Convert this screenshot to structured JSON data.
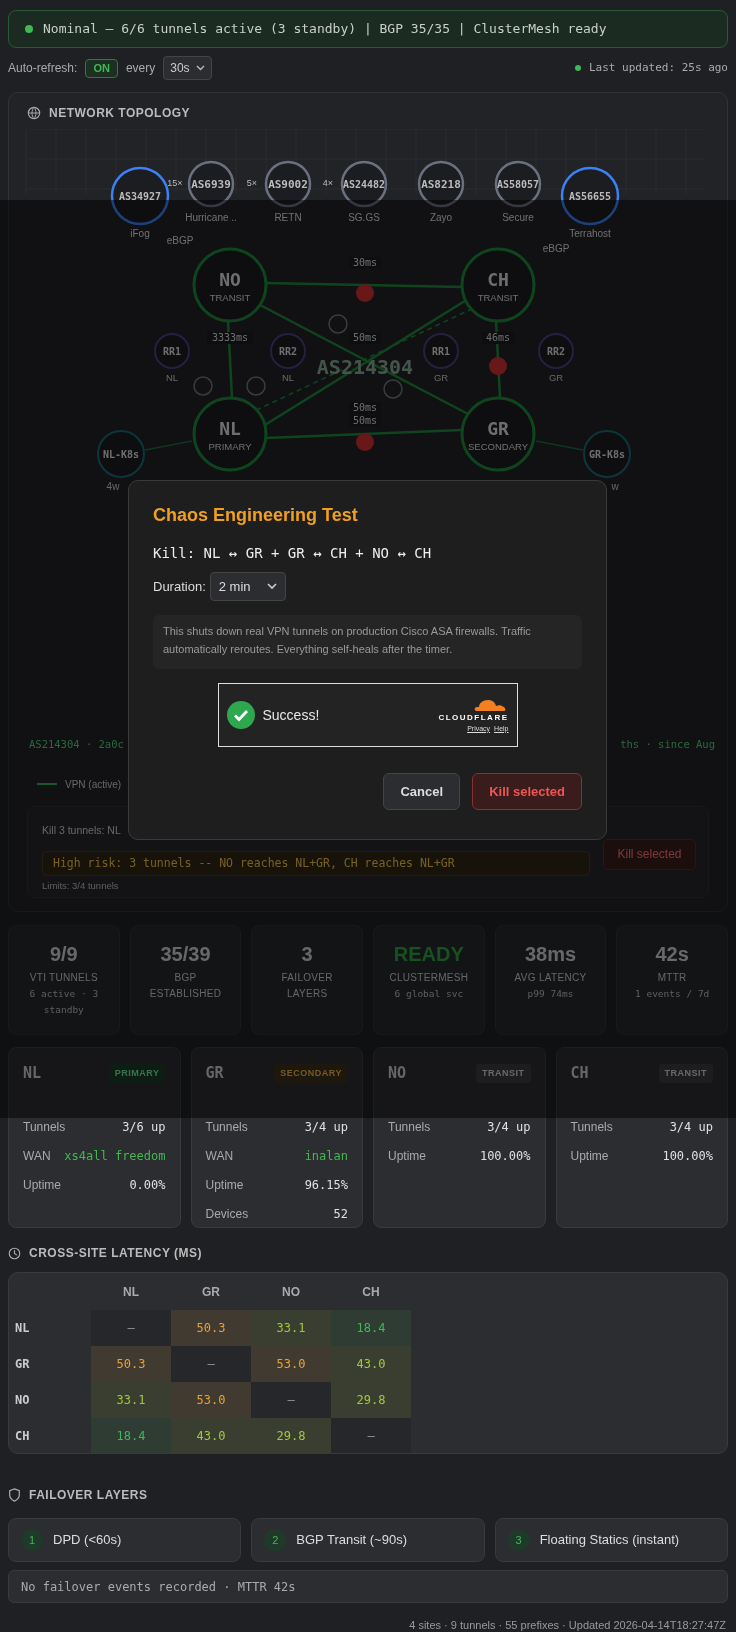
{
  "status_banner": {
    "text": "Nominal — 6/6 tunnels active (3 standby) | BGP 35/35 | ClusterMesh ready",
    "kind": "ok"
  },
  "auto_refresh": {
    "label": "Auto-refresh:",
    "toggle": "ON",
    "on": true,
    "every": "every",
    "interval": "30s"
  },
  "last_updated": {
    "text": "Last updated: 25s ago",
    "kind": "ok"
  },
  "topology": {
    "title": "NETWORK TOPOLOGY",
    "upstreams": [
      {
        "asn": "AS34927",
        "name": "iFog",
        "kind": "direct"
      },
      {
        "asn": "AS6939",
        "name": "Hurricane ..",
        "kind": "transit"
      },
      {
        "asn": "AS9002",
        "name": "RETN",
        "kind": "transit"
      },
      {
        "asn": "AS24482",
        "name": "SG.GS",
        "kind": "transit"
      },
      {
        "asn": "AS8218",
        "name": "Zayo",
        "kind": "transit"
      },
      {
        "asn": "AS58057",
        "name": "Secure",
        "kind": "transit"
      },
      {
        "asn": "AS56655",
        "name": "Terrahost",
        "kind": "direct"
      }
    ],
    "link_counts": [
      "15×",
      "5×",
      "4×"
    ],
    "bgp_labels": [
      "eBGP",
      "eBGP"
    ],
    "sites": [
      {
        "code": "NO",
        "role": "TRANSIT"
      },
      {
        "code": "CH",
        "role": "TRANSIT"
      },
      {
        "code": "NL",
        "role": "PRIMARY"
      },
      {
        "code": "GR",
        "role": "SECONDARY"
      }
    ],
    "links": [
      {
        "kind": "solid",
        "selected": true
      },
      {
        "kind": "solid",
        "selected": false
      },
      {
        "kind": "solid",
        "selected": false
      },
      {
        "kind": "solid",
        "selected": false
      },
      {
        "kind": "solid",
        "selected": true
      },
      {
        "kind": "solid",
        "selected": true
      },
      {
        "kind": "dashed",
        "selected": false
      }
    ],
    "latency_labels": [
      "30ms",
      "3333ms",
      "50ms",
      "46ms",
      "50ms",
      "50ms"
    ],
    "route_reflectors": [
      {
        "label": "RR1",
        "site": "NL"
      },
      {
        "label": "RR2",
        "site": "NL"
      },
      {
        "label": "RR1",
        "site": "GR"
      },
      {
        "label": "RR2",
        "site": "GR"
      }
    ],
    "clusters": [
      {
        "label": "NL-K8s",
        "age": "4w"
      },
      {
        "label": "GR-K8s",
        "age": "w"
      }
    ],
    "asn_label": "AS214304",
    "summary_left": "AS214304 · 2a0c",
    "summary_right": "ths · since Aug",
    "legend": [
      {
        "label": "VPN (active)"
      }
    ],
    "kill_panel": {
      "prompt": "Kill 3 tunnels: NL",
      "risk": "High risk: 3 tunnels -- NO reaches NL+GR, CH reaches NL+GR",
      "button": "Kill selected",
      "limits": "Limits: 3/4 tunnels"
    }
  },
  "stats": [
    {
      "value": "9/9",
      "label": "VTI TUNNELS",
      "detail": "6 active · 3 standby",
      "kind": "plain"
    },
    {
      "value": "35/39",
      "label": "BGP ESTABLISHED",
      "kind": "plain"
    },
    {
      "value": "3",
      "label": "FAILOVER LAYERS",
      "kind": "plain"
    },
    {
      "value": "READY",
      "label": "CLUSTERMESH",
      "detail": "6 global svc",
      "kind": "ok"
    },
    {
      "value": "38ms",
      "label": "AVG LATENCY",
      "detail": "p99 74ms",
      "kind": "plain"
    },
    {
      "value": "42s",
      "label": "MTTR",
      "detail": "1 events / 7d",
      "kind": "plain"
    }
  ],
  "sites": [
    {
      "code": "NL",
      "role": "PRIMARY",
      "rows": [
        {
          "label": "Tunnels",
          "value": "3/6 up",
          "kind": "plain"
        },
        {
          "label": "WAN",
          "value": "xs4all freedom",
          "kind": "link"
        },
        {
          "label": "Uptime",
          "value": "0.00%",
          "kind": "plain"
        }
      ]
    },
    {
      "code": "GR",
      "role": "SECONDARY",
      "rows": [
        {
          "label": "Tunnels",
          "value": "3/4 up",
          "kind": "plain"
        },
        {
          "label": "WAN",
          "value": "inalan",
          "kind": "link"
        },
        {
          "label": "Uptime",
          "value": "96.15%",
          "kind": "plain"
        },
        {
          "label": "Devices",
          "value": "52",
          "kind": "plain"
        }
      ]
    },
    {
      "code": "NO",
      "role": "TRANSIT",
      "rows": [
        {
          "label": "Tunnels",
          "value": "3/4 up",
          "kind": "plain"
        },
        {
          "label": "Uptime",
          "value": "100.00%",
          "kind": "plain"
        }
      ]
    },
    {
      "code": "CH",
      "role": "TRANSIT",
      "rows": [
        {
          "label": "Tunnels",
          "value": "3/4 up",
          "kind": "plain"
        },
        {
          "label": "Uptime",
          "value": "100.00%",
          "kind": "plain"
        }
      ]
    }
  ],
  "latency": {
    "title": "CROSS-SITE LATENCY (MS)",
    "columns": [
      "NL",
      "GR",
      "NO",
      "CH"
    ],
    "rows": [
      {
        "label": "NL",
        "cells": [
          {
            "text": "—"
          },
          {
            "text": "50.3",
            "color": "#e8a33a"
          },
          {
            "text": "33.1",
            "color": "#a3c93a"
          },
          {
            "text": "18.4",
            "color": "#3fb950"
          }
        ]
      },
      {
        "label": "GR",
        "cells": [
          {
            "text": "50.3",
            "color": "#e8a33a"
          },
          {
            "text": "—"
          },
          {
            "text": "53.0",
            "color": "#e8a33a"
          },
          {
            "text": "43.0",
            "color": "#a3c93a"
          }
        ]
      },
      {
        "label": "NO",
        "cells": [
          {
            "text": "33.1",
            "color": "#a3c93a"
          },
          {
            "text": "53.0",
            "color": "#e8a33a"
          },
          {
            "text": "—"
          },
          {
            "text": "29.8",
            "color": "#a3c93a"
          }
        ]
      },
      {
        "label": "CH",
        "cells": [
          {
            "text": "18.4",
            "color": "#3fb950"
          },
          {
            "text": "43.0",
            "color": "#a3c93a"
          },
          {
            "text": "29.8",
            "color": "#a3c93a"
          },
          {
            "text": "—"
          }
        ]
      }
    ]
  },
  "failover": {
    "title": "FAILOVER LAYERS",
    "layers": [
      {
        "number": "1",
        "label": "DPD (<60s)"
      },
      {
        "number": "2",
        "label": "BGP Transit (~90s)"
      },
      {
        "number": "3",
        "label": "Floating Statics (instant)"
      }
    ],
    "events": "No failover events recorded · MTTR 42s"
  },
  "footer": "4 sites · 9 tunnels · 55 prefixes · Updated 2026-04-14T18:27:47Z",
  "modal": {
    "title": "Chaos Engineering Test",
    "kill_line": "Kill: NL ↔ GR + GR ↔ CH + NO ↔ CH",
    "duration_label": "Duration:",
    "duration": "2 min",
    "warning": "This shuts down real VPN tunnels on production Cisco ASA firewalls. Traffic automatically reroutes. Everything self-heals after the timer.",
    "captcha": {
      "status": "Success!",
      "brand": "CLOUDFLARE",
      "links": [
        "Privacy",
        "Help"
      ]
    },
    "buttons": [
      {
        "label": "Cancel",
        "kind": "secondary"
      },
      {
        "label": "Kill selected",
        "kind": "danger"
      }
    ]
  }
}
